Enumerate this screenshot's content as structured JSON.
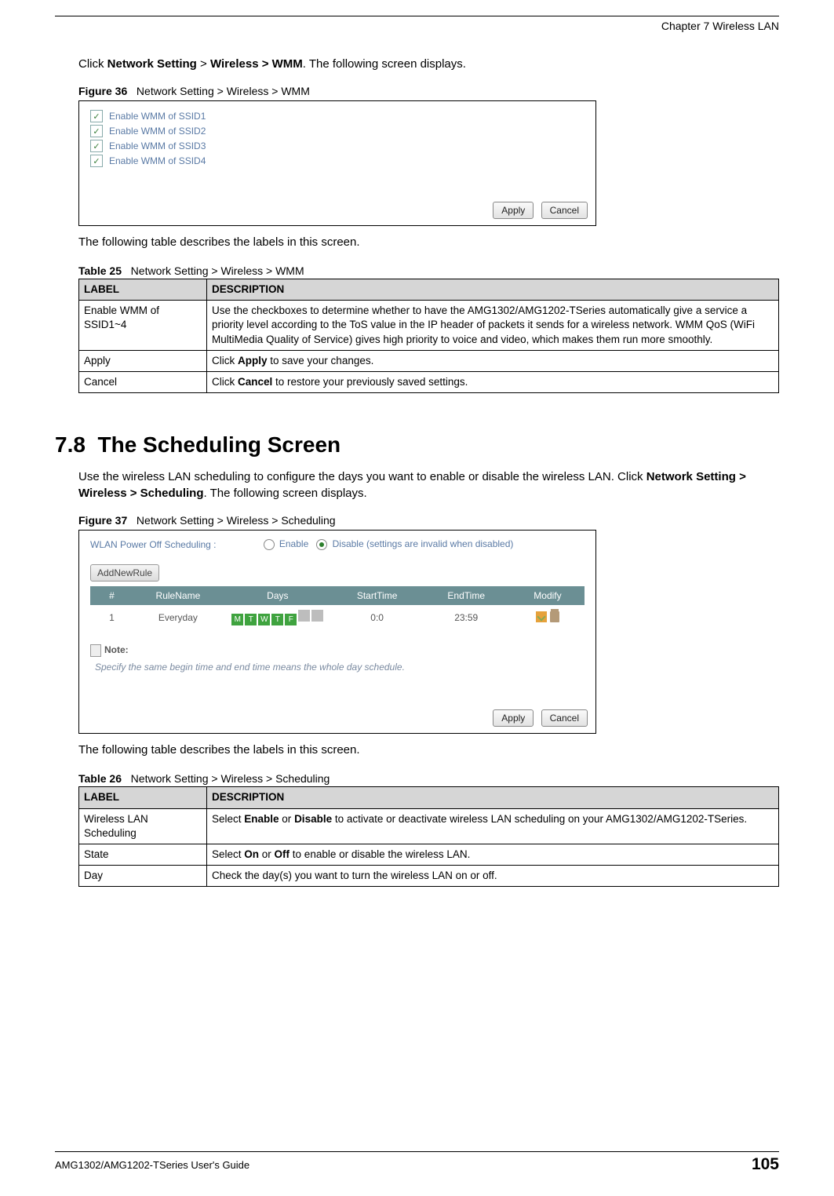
{
  "header": {
    "chapter": "Chapter 7 Wireless LAN"
  },
  "intro_wmm": {
    "pre": "Click ",
    "b1": "Network Setting",
    "mid1": " > ",
    "b2": "Wireless > WMM",
    "post": ". The following screen displays."
  },
  "fig36": {
    "label": "Figure 36",
    "caption": "Network Setting > Wireless > WMM",
    "items": [
      "Enable WMM of SSID1",
      "Enable WMM of SSID2",
      "Enable WMM of SSID3",
      "Enable WMM of SSID4"
    ],
    "apply": "Apply",
    "cancel": "Cancel"
  },
  "after_fig36": "The following table describes the labels in this screen.",
  "table25": {
    "label": "Table 25",
    "caption": "Network Setting > Wireless > WMM",
    "head_label": "LABEL",
    "head_desc": "DESCRIPTION",
    "rows": [
      {
        "label": "Enable WMM of SSID1~4",
        "desc": "Use the checkboxes to determine whether to have the AMG1302/AMG1202-TSeries automatically give a service a priority level according to the ToS value in the IP header of packets it sends for a wireless network. WMM QoS (WiFi MultiMedia Quality of Service) gives high priority to voice and video, which makes them run more smoothly."
      },
      {
        "label": "Apply",
        "desc_pre": "Click ",
        "desc_bold": "Apply",
        "desc_post": " to save your changes."
      },
      {
        "label": "Cancel",
        "desc_pre": "Click ",
        "desc_bold": "Cancel",
        "desc_post": " to restore your previously saved settings."
      }
    ]
  },
  "section78": {
    "num": "7.8",
    "title": "The Scheduling Screen",
    "para_pre": "Use the wireless LAN scheduling to configure the days you want to enable or disable the wireless LAN. Click ",
    "para_bold": "Network Setting > Wireless > Scheduling",
    "para_post": ". The following screen displays."
  },
  "fig37": {
    "label": "Figure 37",
    "caption": "Network Setting > Wireless > Scheduling",
    "top_label": "WLAN Power Off Scheduling :",
    "enable": "Enable",
    "disable": "Disable (settings are invalid when disabled)",
    "add": "AddNewRule",
    "th": [
      "#",
      "RuleName",
      "Days",
      "StartTime",
      "EndTime",
      "Modify"
    ],
    "row": {
      "num": "1",
      "name": "Everyday",
      "days": [
        "M",
        "T",
        "W",
        "T",
        "F",
        "",
        ""
      ],
      "start": "0:0",
      "end": "23:59"
    },
    "note_title": "Note:",
    "note_text": "Specify the same begin time and end time means the whole day schedule.",
    "apply": "Apply",
    "cancel": "Cancel"
  },
  "after_fig37": "The following table describes the labels in this screen.",
  "table26": {
    "label": "Table 26",
    "caption": "Network Setting > Wireless > Scheduling",
    "head_label": "LABEL",
    "head_desc": "DESCRIPTION",
    "rows": [
      {
        "label": "Wireless LAN Scheduling",
        "desc_pre": "Select ",
        "b1": "Enable",
        "mid": " or ",
        "b2": "Disable",
        "desc_post": " to activate or deactivate wireless LAN scheduling on your AMG1302/AMG1202-TSeries."
      },
      {
        "label": "State",
        "desc_pre": "Select ",
        "b1": "On",
        "mid": " or ",
        "b2": "Off",
        "desc_post": " to enable or disable the wireless LAN."
      },
      {
        "label": "Day",
        "desc": "Check the day(s) you want to turn the wireless LAN on or off."
      }
    ]
  },
  "footer": {
    "guide": "AMG1302/AMG1202-TSeries User's Guide",
    "page": "105"
  }
}
